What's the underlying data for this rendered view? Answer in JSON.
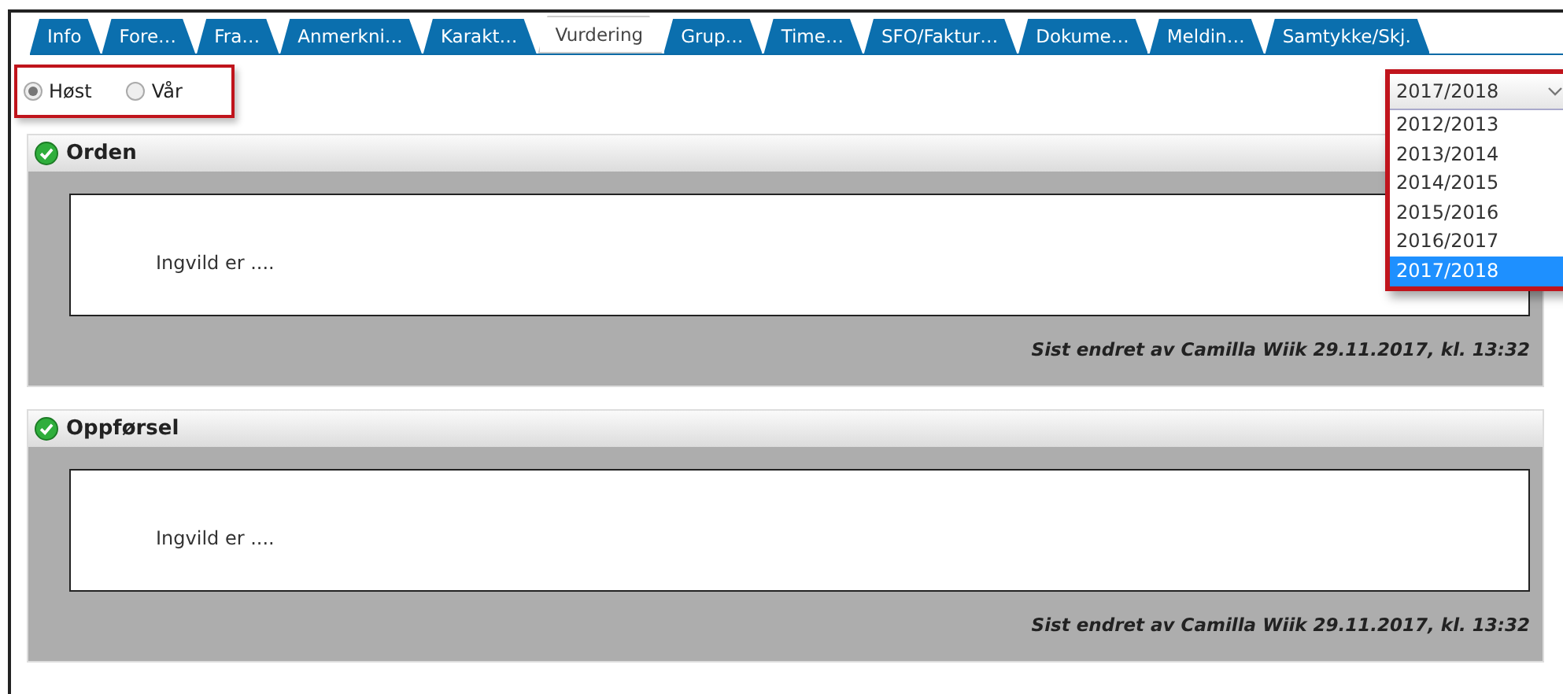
{
  "tabs": [
    {
      "label": "Info",
      "selected": false
    },
    {
      "label": "Fore…",
      "selected": false
    },
    {
      "label": "Fra…",
      "selected": false
    },
    {
      "label": "Anmerkni…",
      "selected": false
    },
    {
      "label": "Karakt…",
      "selected": false
    },
    {
      "label": "Vurdering",
      "selected": true
    },
    {
      "label": "Grup…",
      "selected": false
    },
    {
      "label": "Time…",
      "selected": false
    },
    {
      "label": "SFO/Faktur…",
      "selected": false
    },
    {
      "label": "Dokume…",
      "selected": false
    },
    {
      "label": "Meldin…",
      "selected": false
    },
    {
      "label": "Samtykke/Skj.",
      "selected": false
    }
  ],
  "term_options": [
    {
      "label": "Høst",
      "selected": true
    },
    {
      "label": "Vår",
      "selected": false
    }
  ],
  "year_select": {
    "value": "2017/2018",
    "options": [
      {
        "label": "2012/2013",
        "selected": false
      },
      {
        "label": "2013/2014",
        "selected": false
      },
      {
        "label": "2014/2015",
        "selected": false
      },
      {
        "label": "2015/2016",
        "selected": false
      },
      {
        "label": "2016/2017",
        "selected": false
      },
      {
        "label": "2017/2018",
        "selected": true
      }
    ]
  },
  "sections": [
    {
      "title": "Orden",
      "text": "Ingvild er ....",
      "footer": "Sist endret av Camilla Wiik 29.11.2017, kl. 13:32"
    },
    {
      "title": "Oppførsel",
      "text": "Ingvild er ....",
      "footer": "Sist endret av Camilla Wiik 29.11.2017, kl. 13:32"
    }
  ]
}
